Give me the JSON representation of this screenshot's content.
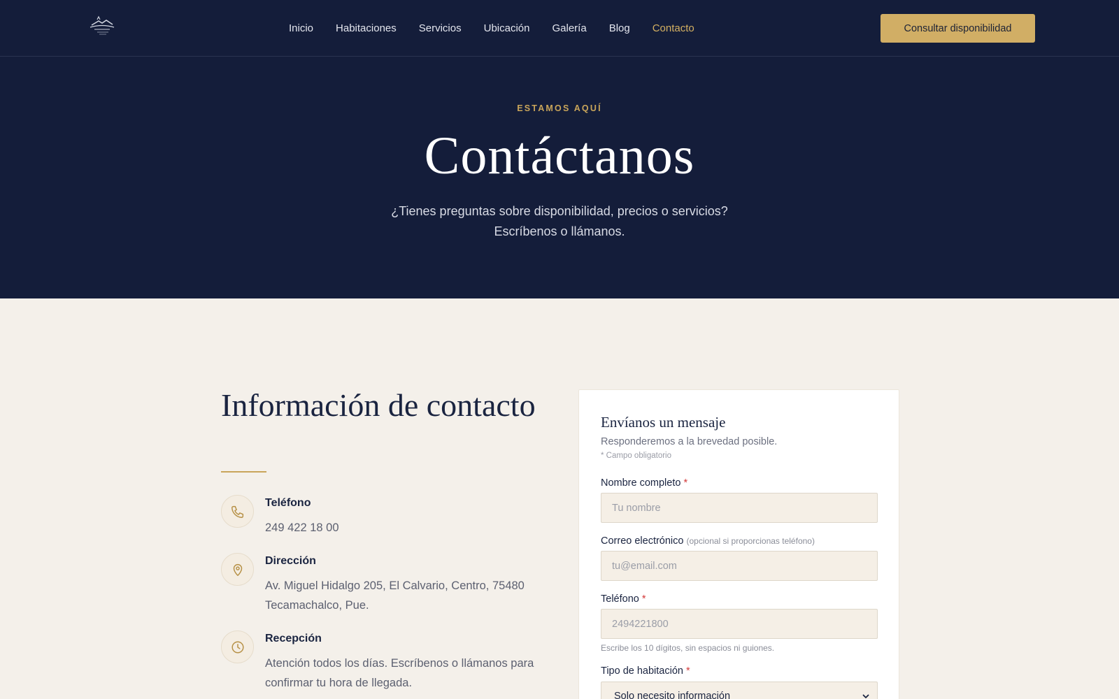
{
  "nav": {
    "items": [
      {
        "label": "Inicio",
        "active": false
      },
      {
        "label": "Habitaciones",
        "active": false
      },
      {
        "label": "Servicios",
        "active": false
      },
      {
        "label": "Ubicación",
        "active": false
      },
      {
        "label": "Galería",
        "active": false
      },
      {
        "label": "Blog",
        "active": false
      },
      {
        "label": "Contacto",
        "active": true
      }
    ],
    "cta_label": "Consultar disponibilidad"
  },
  "hero": {
    "eyebrow": "ESTAMOS AQUÍ",
    "title": "Contáctanos",
    "subtitle_line1": "¿Tienes preguntas sobre disponibilidad, precios o servicios?",
    "subtitle_line2": "Escríbenos o llámanos."
  },
  "info": {
    "title": "Información de contacto",
    "items": [
      {
        "icon": "phone-icon",
        "label": "Teléfono",
        "value": "249 422 18 00"
      },
      {
        "icon": "map-pin-icon",
        "label": "Dirección",
        "value": "Av. Miguel Hidalgo 205, El Calvario, Centro, 75480 Tecamachalco, Pue."
      },
      {
        "icon": "clock-icon",
        "label": "Recepción",
        "value": "Atención todos los días. Escríbenos o llámanos para confirmar tu hora de llegada."
      }
    ]
  },
  "form": {
    "title": "Envíanos un mensaje",
    "subtitle": "Responderemos a la brevedad posible.",
    "required_note": "* Campo obligatorio",
    "name": {
      "label": "Nombre completo",
      "required": "*",
      "placeholder": "Tu nombre"
    },
    "email": {
      "label": "Correo electrónico",
      "note": "(opcional si proporcionas teléfono)",
      "placeholder": "tu@email.com"
    },
    "phone": {
      "label": "Teléfono",
      "required": "*",
      "placeholder": "2494221800",
      "help": "Escribe los 10 dígitos, sin espacios ni guiones."
    },
    "room": {
      "label": "Tipo de habitación",
      "required": "*",
      "selected": "Solo necesito información"
    }
  },
  "colors": {
    "navy": "#141d3a",
    "gold": "#d1ae65",
    "cream": "#f4f0ea"
  }
}
